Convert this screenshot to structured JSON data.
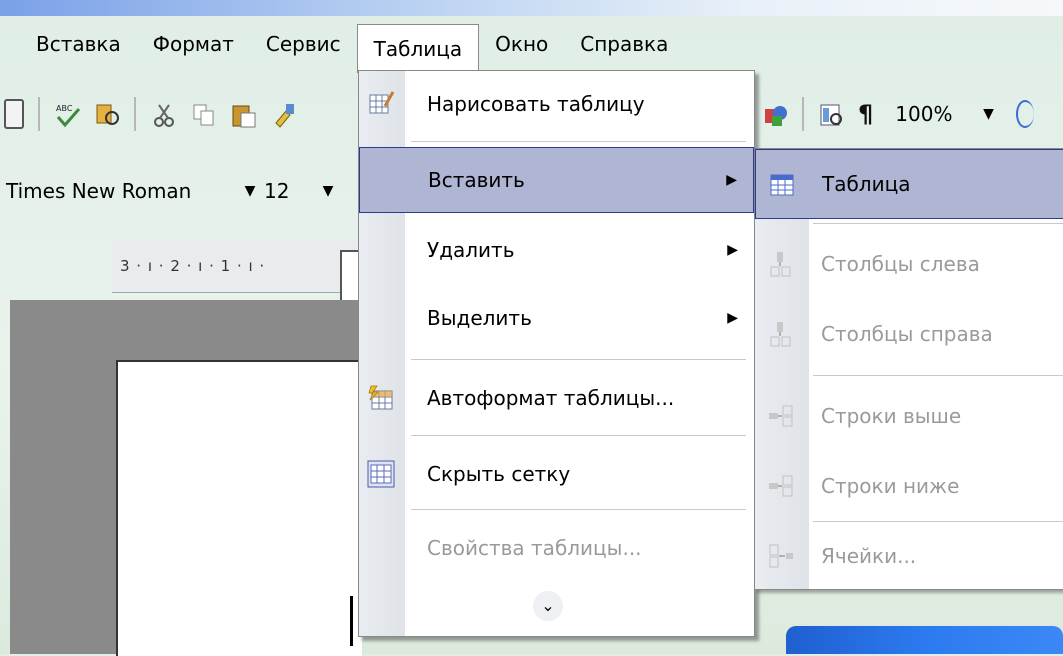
{
  "menubar": {
    "items": [
      {
        "label": "Вставка"
      },
      {
        "label": "Формат"
      },
      {
        "label": "Сервис"
      },
      {
        "label": "Таблица"
      },
      {
        "label": "Окно"
      },
      {
        "label": "Справка"
      }
    ]
  },
  "toolbar": {
    "zoom": "100%",
    "pilcrow": "¶",
    "icons": [
      "print-preview-icon",
      "spelling-icon",
      "research-icon",
      "cut-icon",
      "copy-icon",
      "paste-icon",
      "format-painter-icon",
      "table-icon",
      "show-hide-icon"
    ]
  },
  "format_toolbar": {
    "font_name": "Times New Roman",
    "font_size": "12"
  },
  "ruler": {
    "text": "3 · ı · 2 · ı · 1 · ı ·"
  },
  "table_menu": {
    "items": [
      {
        "label": "Нарисовать таблицу",
        "icon": "draw-table-icon"
      },
      {
        "label": "Вставить",
        "submenu": true,
        "highlighted": true
      },
      {
        "label": "Удалить",
        "submenu": true
      },
      {
        "label": "Выделить",
        "submenu": true
      },
      {
        "label": "Автоформат таблицы...",
        "icon": "autoformat-table-icon"
      },
      {
        "label": "Скрыть сетку",
        "icon": "hide-gridlines-icon"
      },
      {
        "label": "Свойства таблицы...",
        "disabled": true
      }
    ],
    "expand_glyph": "⌄"
  },
  "insert_submenu": {
    "items": [
      {
        "label": "Таблица",
        "highlighted": true,
        "icon": "insert-table-icon"
      },
      {
        "label": "Столбцы слева",
        "disabled": true,
        "icon": "columns-left-icon"
      },
      {
        "label": "Столбцы справа",
        "disabled": true,
        "icon": "columns-right-icon"
      },
      {
        "label": "Строки выше",
        "disabled": true,
        "icon": "rows-above-icon"
      },
      {
        "label": "Строки ниже",
        "disabled": true,
        "icon": "rows-below-icon"
      },
      {
        "label": "Ячейки...",
        "disabled": true,
        "icon": "cells-icon"
      }
    ]
  },
  "colors": {
    "highlight": "#aeb6d4",
    "highlight_border": "#2e3b8a",
    "disabled_text": "#9a9a9a"
  }
}
